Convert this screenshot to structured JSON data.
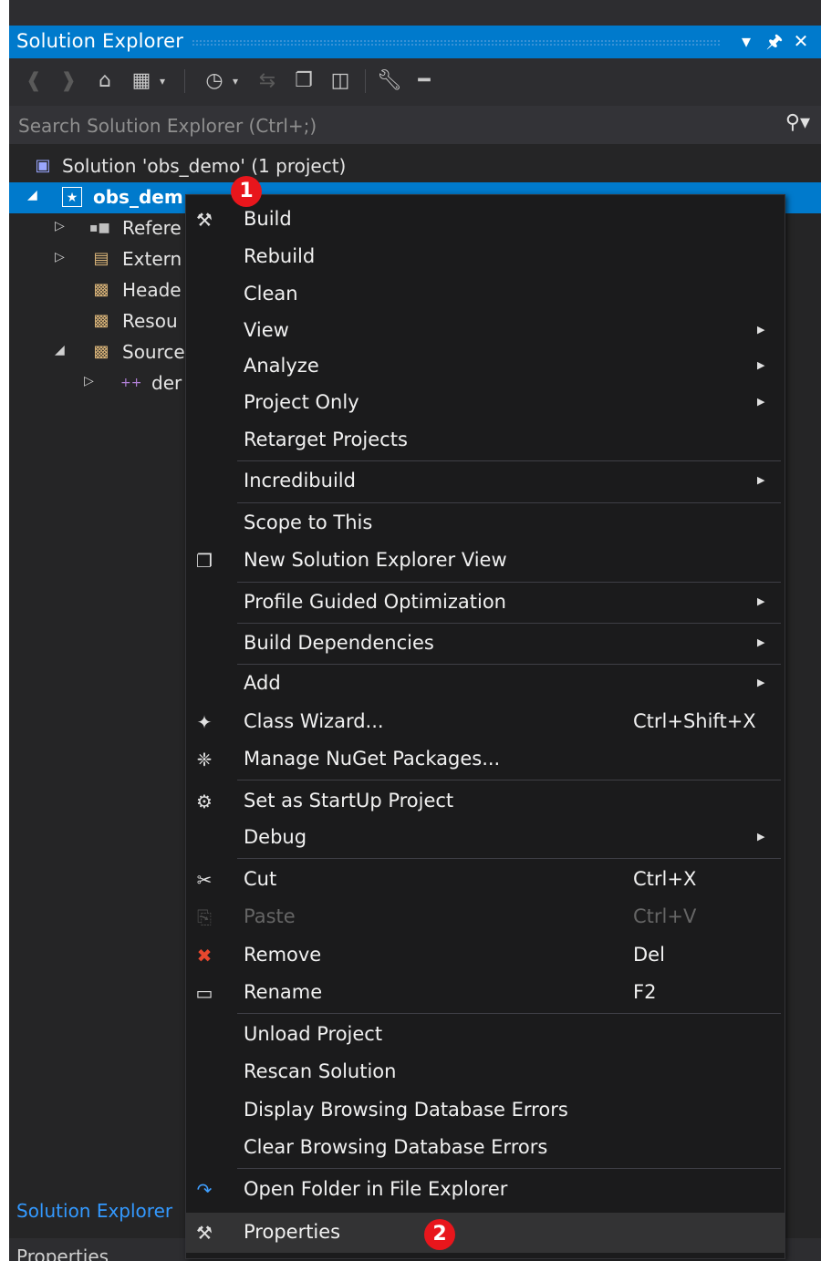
{
  "panel": {
    "title": "Solution Explorer",
    "pin": "↓",
    "auto_hide": "I",
    "close": "✕"
  },
  "search": {
    "placeholder": "Search Solution Explorer (Ctrl+;)",
    "icon": "⌕"
  },
  "tree": [
    {
      "label": "Solution 'obs_demo' (1 project)",
      "icon": "solution-icon",
      "arrow": ""
    },
    {
      "label": "obs_dem",
      "icon": "project-icon",
      "arrow": "◢",
      "selected": true
    },
    {
      "label": "Refere",
      "icon": "references-icon",
      "arrow": "▷"
    },
    {
      "label": "Extern",
      "icon": "external-deps-icon",
      "arrow": "▷"
    },
    {
      "label": "Heade",
      "icon": "folder-icon",
      "arrow": ""
    },
    {
      "label": "Resou",
      "icon": "folder-icon",
      "arrow": ""
    },
    {
      "label": "Source",
      "icon": "folder-icon",
      "arrow": "◢"
    },
    {
      "label": "der",
      "icon": "cpp-file-icon",
      "arrow": "▷"
    }
  ],
  "context_menu": {
    "items": [
      {
        "label": "Build",
        "icon": "build-icon",
        "glyph": "⚒"
      },
      {
        "label": "Rebuild"
      },
      {
        "label": "Clean"
      },
      {
        "label": "View",
        "submenu": true
      },
      {
        "label": "Analyze",
        "submenu": true
      },
      {
        "label": "Project Only",
        "submenu": true
      },
      {
        "label": "Retarget Projects"
      },
      {
        "label": "Incredibuild",
        "submenu": true
      },
      {
        "label": "Scope to This"
      },
      {
        "label": "New Solution Explorer View",
        "icon": "new-view-icon",
        "glyph": "❐"
      },
      {
        "label": "Profile Guided Optimization",
        "submenu": true
      },
      {
        "label": "Build Dependencies",
        "submenu": true
      },
      {
        "label": "Add",
        "submenu": true
      },
      {
        "label": "Class Wizard...",
        "shortcut": "Ctrl+Shift+X",
        "icon": "class-wizard-icon",
        "glyph": "✦"
      },
      {
        "label": "Manage NuGet Packages...",
        "icon": "nuget-icon",
        "glyph": "❈"
      },
      {
        "label": "Set as StartUp Project",
        "icon": "gear-icon",
        "glyph": "⚙"
      },
      {
        "label": "Debug",
        "submenu": true
      },
      {
        "label": "Cut",
        "shortcut": "Ctrl+X",
        "icon": "scissors-icon",
        "glyph": "✂"
      },
      {
        "label": "Paste",
        "shortcut": "Ctrl+V",
        "icon": "paste-icon",
        "glyph": "⎘",
        "disabled": true
      },
      {
        "label": "Remove",
        "shortcut": "Del",
        "icon": "remove-icon",
        "glyph": "✖",
        "color": "#e8472e"
      },
      {
        "label": "Rename",
        "shortcut": "F2",
        "icon": "rename-icon",
        "glyph": "▭"
      },
      {
        "label": "Unload Project"
      },
      {
        "label": "Rescan Solution"
      },
      {
        "label": "Display Browsing Database Errors"
      },
      {
        "label": "Clear Browsing Database Errors"
      },
      {
        "label": "Open Folder in File Explorer",
        "icon": "open-folder-icon",
        "glyph": "↷",
        "color": "#3f9fff"
      },
      {
        "label": "Properties",
        "icon": "wrench-icon",
        "glyph": "⚒",
        "hover": true
      }
    ]
  },
  "annotations": {
    "badge1": "1",
    "badge2": "2"
  },
  "bottom": {
    "tab": "Solution Explorer",
    "next_panel": "Properties"
  }
}
